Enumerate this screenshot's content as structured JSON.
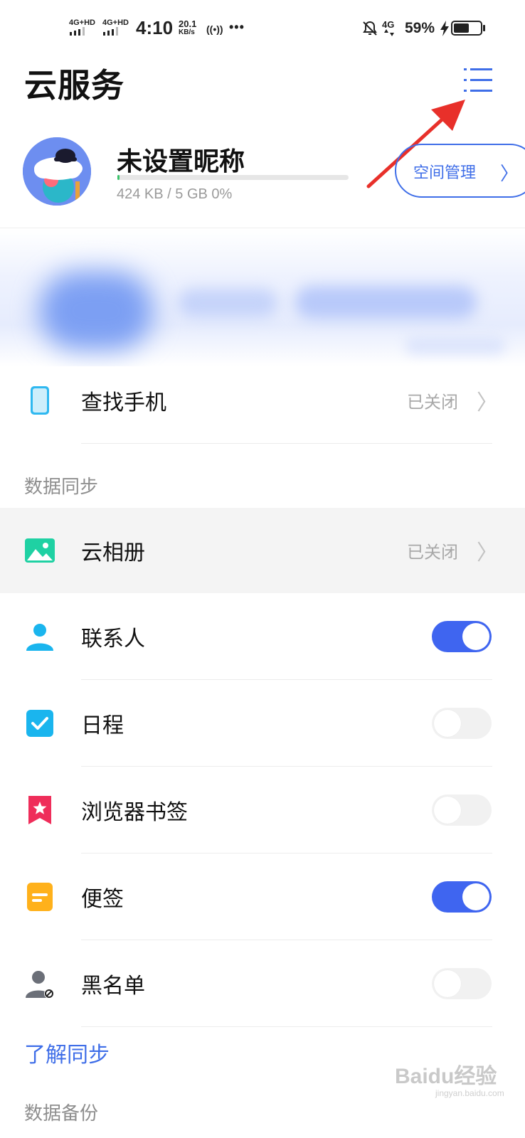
{
  "status_bar": {
    "net1": "4G+HD",
    "net2": "4G+HD",
    "time": "4:10",
    "speed_value": "20.1",
    "speed_unit": "KB/s",
    "hotspot": "((•))",
    "more": "•••",
    "net3": "4G",
    "battery_text": "59%",
    "battery_level": 0.59
  },
  "header": {
    "title": "云服务"
  },
  "profile": {
    "nickname": "未设置昵称",
    "usage_text": "424 KB / 5 GB 0%",
    "usage_fraction": 0.01,
    "space_button": "空间管理",
    "space_chevron": "〉"
  },
  "find_phone": {
    "label": "查找手机",
    "status": "已关闭",
    "chevron": "〉"
  },
  "sync": {
    "section_title": "数据同步",
    "album": {
      "label": "云相册",
      "status": "已关闭",
      "chevron": "〉"
    },
    "items": [
      {
        "label": "联系人",
        "on": true
      },
      {
        "label": "日程",
        "on": false
      },
      {
        "label": "浏览器书签",
        "on": false
      },
      {
        "label": "便签",
        "on": true
      },
      {
        "label": "黑名单",
        "on": false
      }
    ],
    "learn_more": "了解同步"
  },
  "backup": {
    "section_title": "数据备份"
  },
  "watermark": {
    "text": "Baidu经验",
    "sub": "jingyan.baidu.com"
  },
  "colors": {
    "accent": "#3f6ee8",
    "toggle_on": "#3f65f0",
    "annotation_arrow": "#e8302a"
  }
}
